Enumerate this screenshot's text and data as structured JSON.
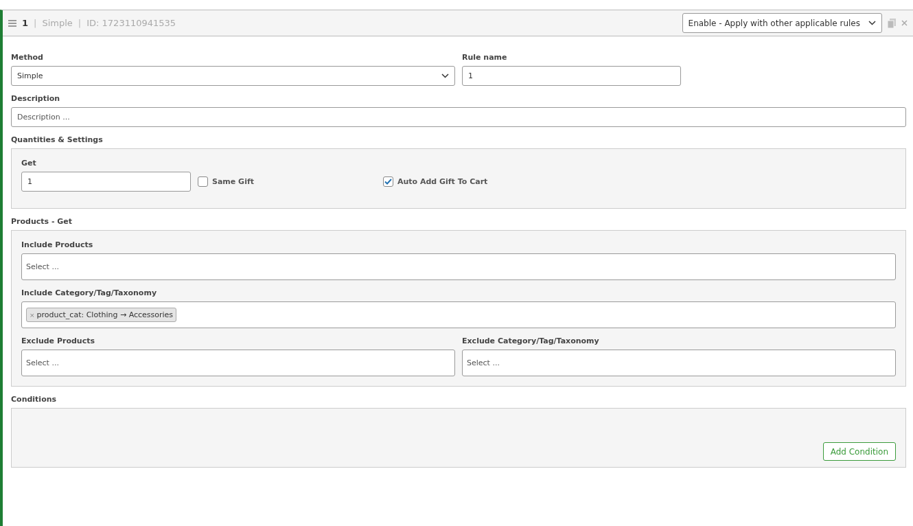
{
  "header": {
    "items": [
      {
        "kind": "number",
        "text": "1"
      },
      {
        "kind": "sep",
        "text": "|"
      },
      {
        "kind": "muted",
        "text": "Simple"
      },
      {
        "kind": "sep",
        "text": "|"
      },
      {
        "kind": "muted",
        "text": "ID: 1723110941535"
      }
    ],
    "status_select": "Enable - Apply with other applicable rules"
  },
  "method": {
    "label": "Method",
    "value": "Simple"
  },
  "rule_name": {
    "label": "Rule name",
    "value": "1"
  },
  "description": {
    "label": "Description",
    "placeholder": "Description ..."
  },
  "quantities": {
    "title": "Quantities & Settings",
    "get": {
      "label": "Get",
      "value": "1"
    },
    "checks": [
      {
        "label": "Same Gift",
        "checked": false
      },
      {
        "label": "Auto Add Gift To Cart",
        "checked": true
      }
    ]
  },
  "products": {
    "title": "Products - Get",
    "include_products": {
      "label": "Include Products",
      "placeholder": "Select ..."
    },
    "include_category": {
      "label": "Include Category/Tag/Taxonomy",
      "tags": [
        {
          "remove": "×",
          "label": "product_cat: Clothing → Accessories"
        }
      ]
    },
    "exclude_products": {
      "label": "Exclude Products",
      "placeholder": "Select ..."
    },
    "exclude_category": {
      "label": "Exclude Category/Tag/Taxonomy",
      "placeholder": "Select ..."
    }
  },
  "conditions": {
    "title": "Conditions",
    "button": "Add Condition"
  }
}
